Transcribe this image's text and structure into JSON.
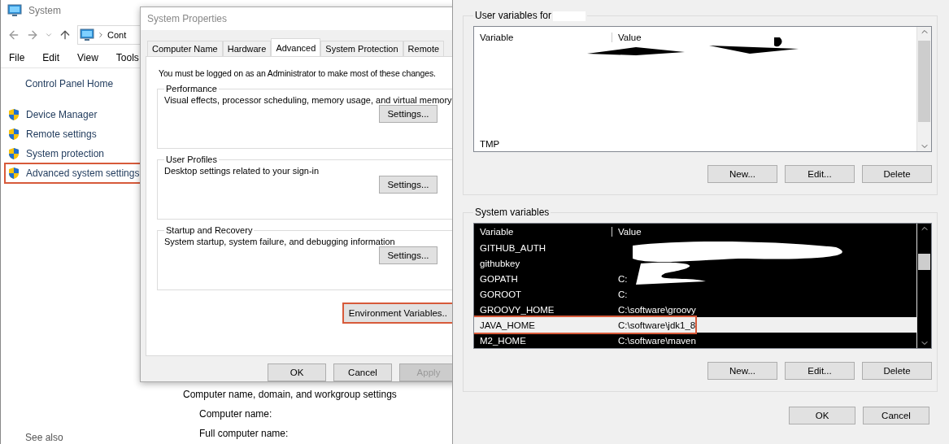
{
  "system_window": {
    "title": "System",
    "address": "Cont",
    "menu": [
      "File",
      "Edit",
      "View",
      "Tools"
    ],
    "home_link": "Control Panel Home",
    "nav_links": [
      {
        "label": "Device Manager",
        "highlighted": false
      },
      {
        "label": "Remote settings",
        "highlighted": false
      },
      {
        "label": "System protection",
        "highlighted": false
      },
      {
        "label": "Advanced system settings",
        "highlighted": true
      }
    ],
    "see_also": "See also",
    "section": {
      "title": "Computer name, domain, and workgroup settings",
      "fields": [
        "Computer name:",
        "Full computer name:"
      ]
    }
  },
  "system_properties": {
    "title": "System Properties",
    "tabs": [
      {
        "label": "Computer Name",
        "selected": false
      },
      {
        "label": "Hardware",
        "selected": false
      },
      {
        "label": "Advanced",
        "selected": true
      },
      {
        "label": "System Protection",
        "selected": false
      },
      {
        "label": "Remote",
        "selected": false
      }
    ],
    "notice": "You must be logged on as an Administrator to make most of these changes.",
    "groups": [
      {
        "title": "Performance",
        "description": "Visual effects, processor scheduling, memory usage, and virtual memory",
        "button": "Settings..."
      },
      {
        "title": "User Profiles",
        "description": "Desktop settings related to your sign-in",
        "button": "Settings..."
      },
      {
        "title": "Startup and Recovery",
        "description": "System startup, system failure, and debugging information",
        "button": "Settings..."
      }
    ],
    "env_button": {
      "label": "Environment Variables..",
      "highlighted": true
    },
    "buttons": [
      {
        "label": "OK",
        "disabled": false
      },
      {
        "label": "Cancel",
        "disabled": false
      },
      {
        "label": "Apply",
        "disabled": true
      }
    ]
  },
  "environment_variables": {
    "user_group": {
      "title": "User variables for",
      "columns": [
        "Variable",
        "Value"
      ],
      "rows": [
        {
          "variable": "TMP",
          "selected": false
        }
      ],
      "buttons": [
        "New...",
        "Edit...",
        "Delete"
      ]
    },
    "system_group": {
      "title": "System variables",
      "columns": [
        "Variable",
        "Value"
      ],
      "rows": [
        {
          "variable": "GITHUB_AUTH",
          "selected": false,
          "highlighted": false
        },
        {
          "variable": "githubkey",
          "selected": false,
          "highlighted": false
        },
        {
          "variable": "GOPATH",
          "value": "C:",
          "selected": false,
          "highlighted": false
        },
        {
          "variable": "GOROOT",
          "value": "C:",
          "selected": false,
          "highlighted": false
        },
        {
          "variable": "GROOVY_HOME",
          "value": "C:\\software\\groovy",
          "selected": false,
          "highlighted": false
        },
        {
          "variable": "JAVA_HOME",
          "value": "C:\\software\\jdk1_8",
          "selected": true,
          "highlighted": true
        },
        {
          "variable": "M2_HOME",
          "value": "C:\\software\\maven",
          "selected": false,
          "highlighted": false
        }
      ],
      "buttons": [
        "New...",
        "Edit...",
        "Delete"
      ]
    },
    "buttons": [
      "OK",
      "Cancel"
    ]
  }
}
